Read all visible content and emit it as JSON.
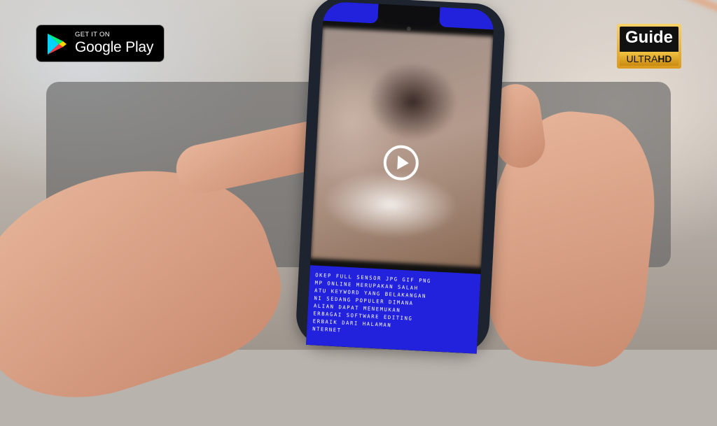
{
  "store_badge": {
    "top_text": "GET IT ON",
    "store_name": "Google Play",
    "icon": "google-play-icon"
  },
  "brand_logo": {
    "title": "Guide",
    "subtitle_light": "ULTRA",
    "subtitle_bold": "HD"
  },
  "phone": {
    "video": {
      "play_icon": "play-icon"
    },
    "description_lines": [
      "OKEP FULL SENSOR JPG GIF PNG",
      "MP ONLINE MERUPAKAN SALAH",
      "ATU KEYWORD YANG BELAKANGAN",
      "NI SEDANG POPULER DIMANA",
      "ALIAN DAPAT MENEMUKAN",
      "ERBAGAI SOFTWARE EDITING",
      "ERBAIK DARI HALAMAN",
      "NTERNET"
    ]
  },
  "colors": {
    "screen_accent": "#2222dd",
    "logo_gold": "#f2c443",
    "panel_overlay": "#5f5f5f"
  }
}
